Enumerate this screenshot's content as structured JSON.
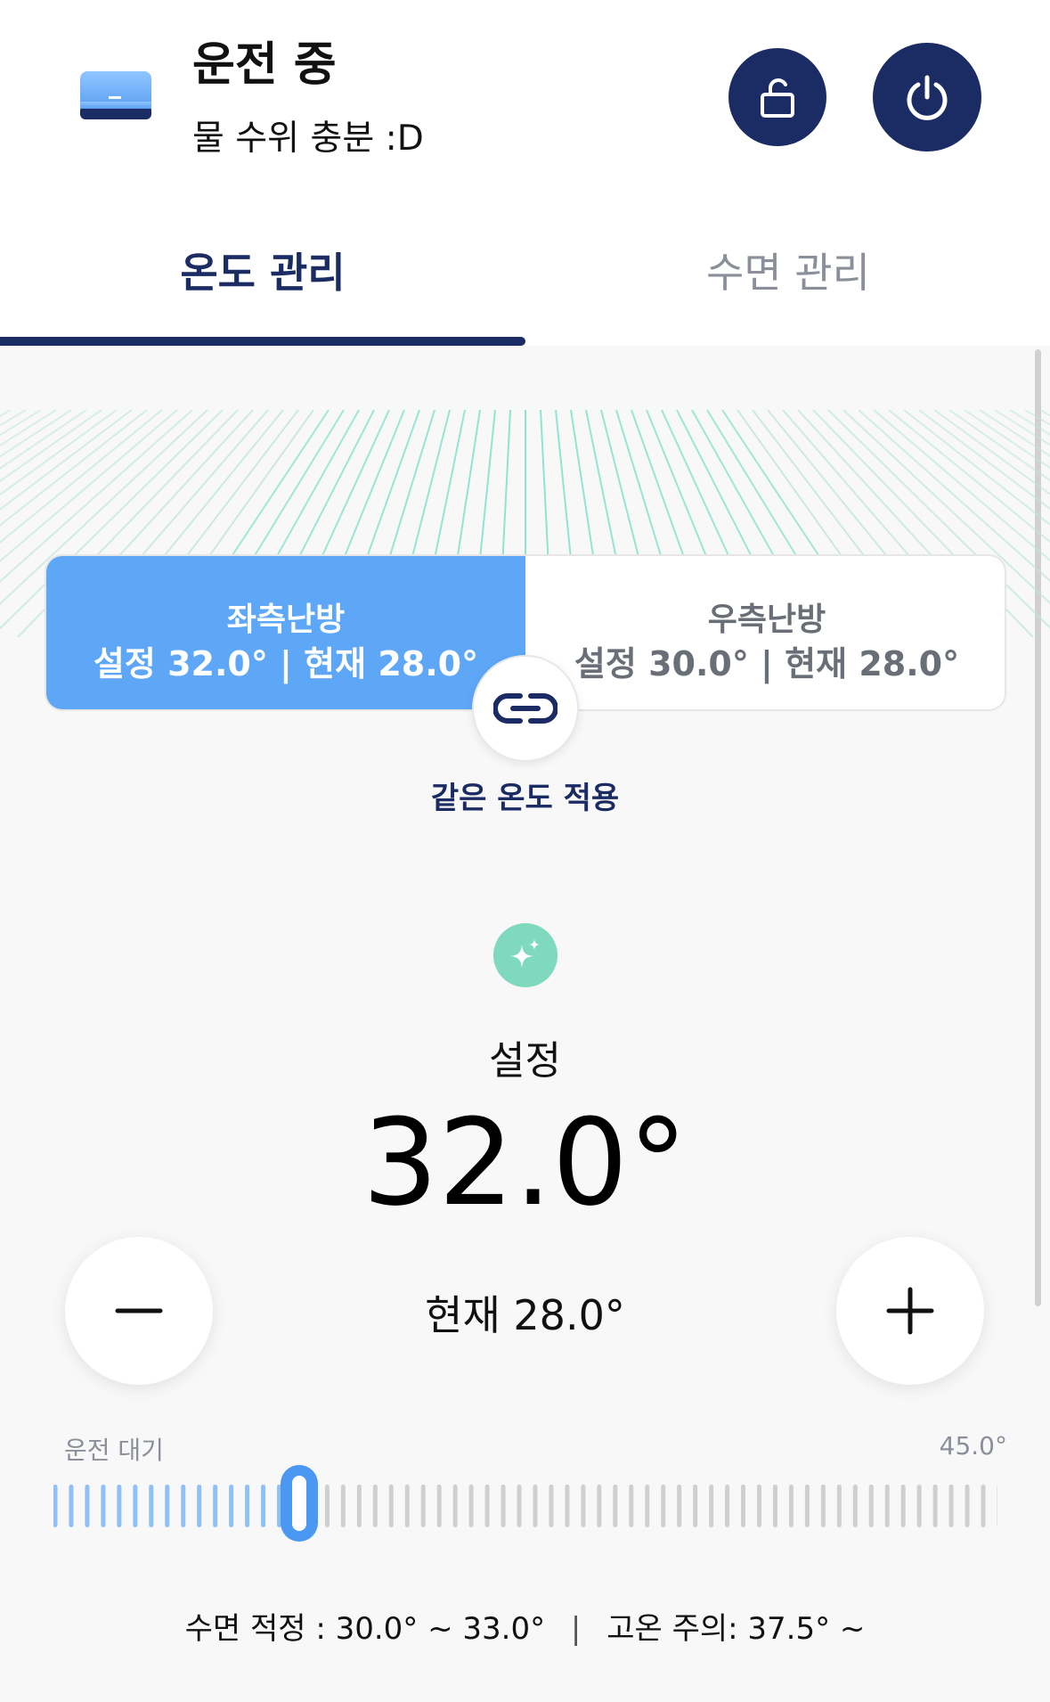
{
  "header": {
    "status_title": "운전 중",
    "status_subtitle": "물 수위 충분 :D",
    "device_icon": "mattress-device-icon",
    "lock_icon": "unlock-icon",
    "power_icon": "power-icon"
  },
  "tabs": [
    {
      "label": "온도 관리",
      "active": true
    },
    {
      "label": "수면 관리",
      "active": false
    }
  ],
  "heat": {
    "left": {
      "name": "좌측난방",
      "values": "설정 32.0° | 현재 28.0°",
      "selected": true
    },
    "right": {
      "name": "우측난방",
      "values": "설정 30.0° | 현재 28.0°",
      "selected": false
    },
    "link_label": "같은 온도 적용"
  },
  "control": {
    "set_label": "설정",
    "set_value": "32.0°",
    "current_value": "현재 28.0°"
  },
  "range": {
    "min_label": "운전 대기",
    "max_label": "45.0°",
    "level": 0.26
  },
  "footer": {
    "sleep_range": "수면 적정 : 30.0° ~ 33.0°",
    "separator": "|",
    "high_temp": "고온 주의: 37.5° ~"
  },
  "colors": {
    "primary": "#1b2b64",
    "accent_blue": "#5ea7f7",
    "mint": "#7fd9be",
    "tick_active": "#8fc0f7",
    "tick_inactive": "#cfcfcf"
  }
}
